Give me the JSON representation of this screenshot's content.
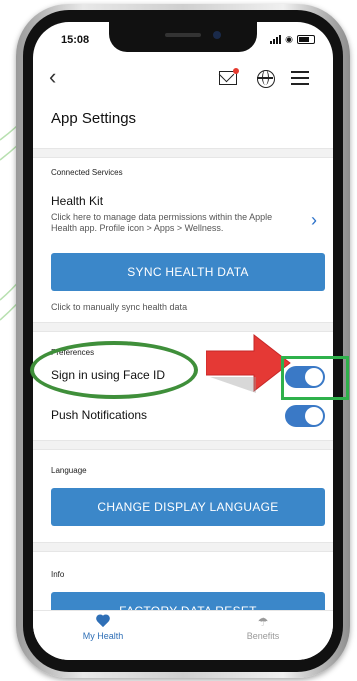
{
  "status_bar": {
    "time": "15:08"
  },
  "nav": {
    "back_icon": "chevron-left-icon",
    "mail_icon": "mail-icon",
    "globe_icon": "globe-icon",
    "menu_icon": "menu-icon"
  },
  "page": {
    "title": "App Settings"
  },
  "connected_services": {
    "section_label": "Connected Services",
    "health_kit_title": "Health Kit",
    "health_kit_desc": "Click here to manage data permissions within the Apple Health app. Profile icon > Apps > Wellness.",
    "sync_button": "SYNC HEALTH DATA",
    "sync_hint": "Click to manually sync health data"
  },
  "preferences": {
    "section_label": "Preferences",
    "items": [
      {
        "label": "Sign in using Face ID",
        "enabled": true
      },
      {
        "label": "Push Notifications",
        "enabled": true
      }
    ]
  },
  "language": {
    "section_label": "Language",
    "button": "CHANGE DISPLAY LANGUAGE"
  },
  "info": {
    "section_label": "Info",
    "button": "FACTORY DATA RESET"
  },
  "tabbar": {
    "tabs": [
      {
        "label": "My Health",
        "icon": "heart-icon",
        "active": true
      },
      {
        "label": "Benefits",
        "icon": "umbrella-icon",
        "active": false
      }
    ]
  },
  "colors": {
    "accent": "#3b87c9",
    "toggle_on": "#3a79c6",
    "annotation_green": "#3f8f3a",
    "annotation_red": "#e53935"
  }
}
